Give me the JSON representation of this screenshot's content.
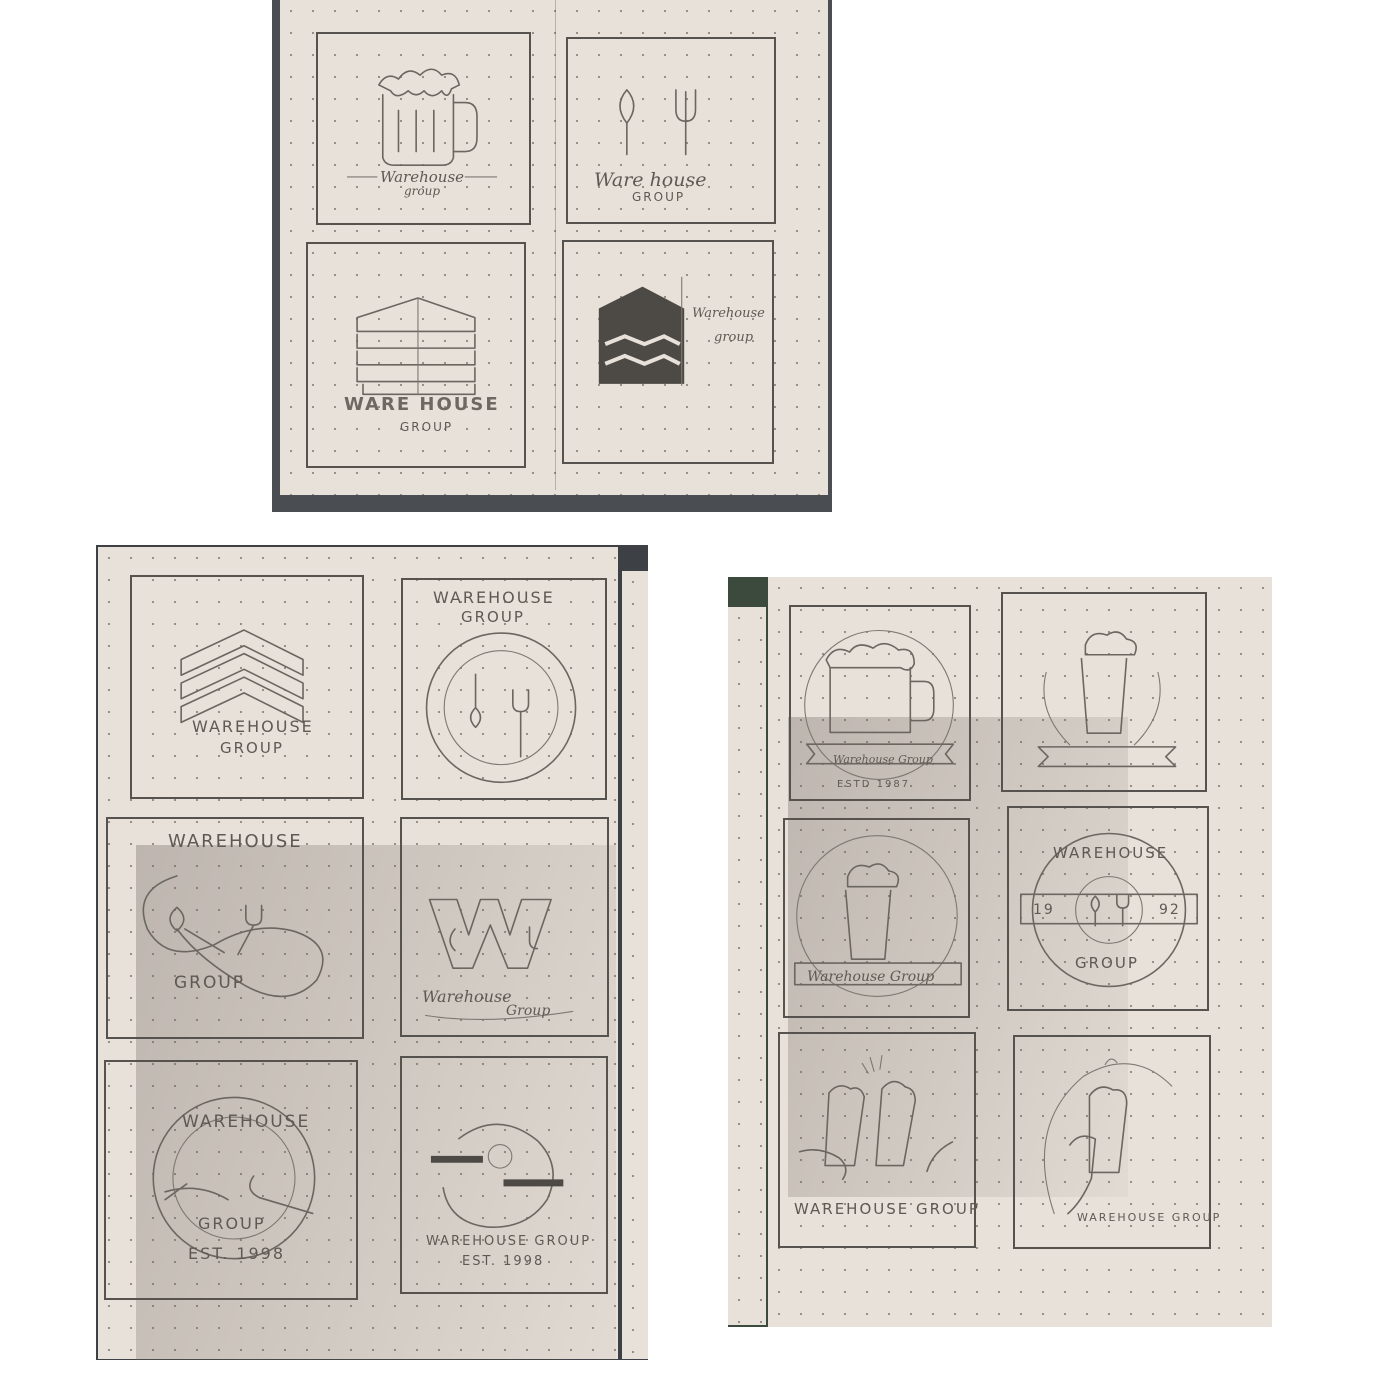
{
  "photos": [
    {
      "sketches": [
        {
          "lines": [
            "Warehouse",
            "group"
          ],
          "motif": "beer-mug-icon"
        },
        {
          "lines": [
            "Ware house",
            "GROUP"
          ],
          "motif": "spoon-fork-icon"
        },
        {
          "lines": [
            "WARE HOUSE",
            "GROUP"
          ],
          "motif": "stacked-boards-icon"
        },
        {
          "lines": [
            "Warehouse",
            "group"
          ],
          "motif": "chevron-block-icon"
        }
      ]
    },
    {
      "sketches": [
        {
          "lines": [
            "WAREHOUSE",
            "GROUP"
          ],
          "motif": "chevrons-icon"
        },
        {
          "lines": [
            "WAREHOUSE",
            "GROUP"
          ],
          "motif": "plate-cutlery-icon"
        },
        {
          "lines": [
            "WAREHOUSE",
            "GROUP"
          ],
          "motif": "infinity-cutlery-icon"
        },
        {
          "lines": [
            "Warehouse",
            "Group"
          ],
          "motif": "w-letter-icon"
        },
        {
          "lines": [
            "WAREHOUSE",
            "GROUP",
            "EST. 1998"
          ],
          "motif": "circle-badge-icon"
        },
        {
          "lines": [
            "WAREHOUSE GROUP",
            "EST. 1998"
          ],
          "motif": "bitten-plate-icon"
        }
      ]
    },
    {
      "sketches": [
        {
          "lines": [
            "Warehouse Group",
            "ESTD 1987"
          ],
          "motif": "beer-mug-banner-icon"
        },
        {
          "lines": [],
          "motif": "pint-wreath-icon"
        },
        {
          "lines": [
            "Warehouse Group"
          ],
          "motif": "pint-circle-icon"
        },
        {
          "lines": [
            "WAREHOUSE",
            "19",
            "92",
            "GROUP"
          ],
          "motif": "cutlery-seal-icon"
        },
        {
          "lines": [
            "WAREHOUSE GROUP"
          ],
          "motif": "cheers-icon"
        },
        {
          "lines": [
            "WAREHOUSE GROUP"
          ],
          "motif": "hand-pint-icon"
        }
      ]
    }
  ]
}
